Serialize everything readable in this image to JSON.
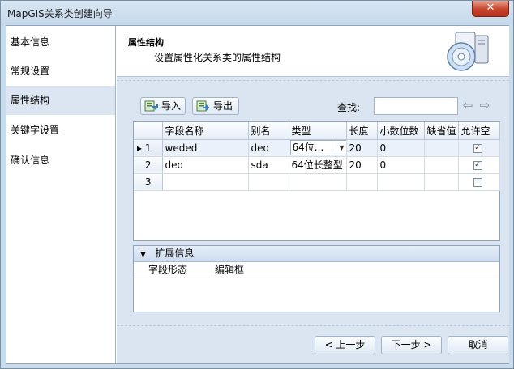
{
  "window": {
    "title": "MapGIS关系类创建向导",
    "close_glyph": "✕"
  },
  "sidebar": {
    "items": [
      {
        "label": "基本信息"
      },
      {
        "label": "常规设置"
      },
      {
        "label": "属性结构"
      },
      {
        "label": "关键字设置"
      },
      {
        "label": "确认信息"
      }
    ],
    "active_index": 2
  },
  "header": {
    "title": "属性结构",
    "subtitle": "设置属性化关系类的属性结构"
  },
  "toolbar": {
    "import_label": "导入",
    "export_label": "导出",
    "search_label": "查找:",
    "search_value": ""
  },
  "grid": {
    "columns": [
      "",
      "字段名称",
      "别名",
      "类型",
      "长度",
      "小数位数",
      "缺省值",
      "允许空"
    ],
    "rows": [
      {
        "row_label": "1",
        "selected": true,
        "name": "weded",
        "alias": "ded",
        "type": "64位...",
        "length": "20",
        "decimals": "0",
        "default": "",
        "nullable": true
      },
      {
        "row_label": "2",
        "selected": false,
        "name": "ded",
        "alias": "sda",
        "type": "64位长整型",
        "length": "20",
        "decimals": "0",
        "default": "",
        "nullable": true
      },
      {
        "row_label": "3",
        "selected": false,
        "name": "",
        "alias": "",
        "type": "",
        "length": "",
        "decimals": "",
        "default": "",
        "nullable": false
      }
    ],
    "current_row_marker": "▸"
  },
  "extended": {
    "title": "扩展信息",
    "rows": [
      {
        "key": "字段形态",
        "value": "编辑框"
      }
    ]
  },
  "buttons": {
    "prev": "< 上一步",
    "next": "下一步 >",
    "cancel": "取消"
  },
  "colors": {
    "accent": "#dbe6f2",
    "background": "#dbe5f1",
    "border": "#8ea3bc"
  }
}
